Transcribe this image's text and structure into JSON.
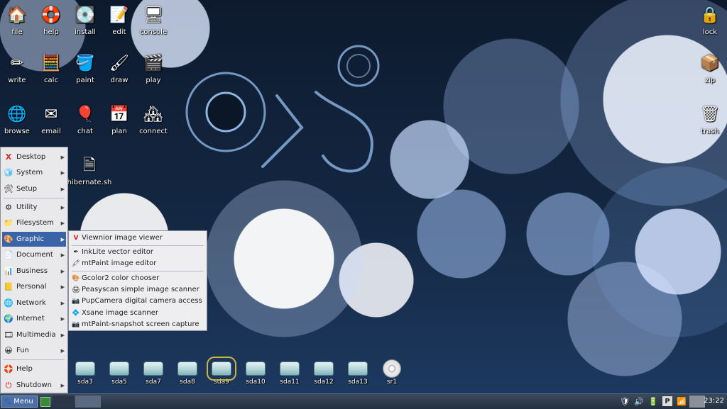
{
  "desktop_icons": [
    {
      "label": "file",
      "icon": "home-folder-icon"
    },
    {
      "label": "help",
      "icon": "lifebuoy-icon"
    },
    {
      "label": "install",
      "icon": "install-icon"
    },
    {
      "label": "edit",
      "icon": "edit-icon"
    },
    {
      "label": "console",
      "icon": "terminal-icon"
    },
    {
      "label": "write",
      "icon": "pen-icon"
    },
    {
      "label": "calc",
      "icon": "calculator-icon"
    },
    {
      "label": "paint",
      "icon": "paint-bucket-icon"
    },
    {
      "label": "draw",
      "icon": "draw-icon"
    },
    {
      "label": "play",
      "icon": "media-play-icon"
    },
    {
      "label": "browse",
      "icon": "globe-icon"
    },
    {
      "label": "email",
      "icon": "envelope-icon"
    },
    {
      "label": "chat",
      "icon": "chat-balloon-icon"
    },
    {
      "label": "plan",
      "icon": "calendar-icon"
    },
    {
      "label": "connect",
      "icon": "network-connect-icon"
    },
    {
      "label": "hibernate.sh",
      "icon": "script-file-icon"
    }
  ],
  "right_icons": [
    {
      "label": "lock",
      "icon": "padlock-icon"
    },
    {
      "label": "zip",
      "icon": "archive-box-icon"
    },
    {
      "label": "trash",
      "icon": "trash-can-icon"
    }
  ],
  "menu": {
    "items": [
      {
        "label": "Desktop",
        "icon": "desktop-x-icon"
      },
      {
        "label": "System",
        "icon": "system-icon"
      },
      {
        "label": "Setup",
        "icon": "setup-tools-icon"
      },
      {
        "label": "Utility",
        "icon": "utility-icon"
      },
      {
        "label": "Filesystem",
        "icon": "folder-icon"
      },
      {
        "label": "Graphic",
        "icon": "graphic-icon"
      },
      {
        "label": "Document",
        "icon": "document-icon"
      },
      {
        "label": "Business",
        "icon": "business-icon"
      },
      {
        "label": "Personal",
        "icon": "personal-icon"
      },
      {
        "label": "Network",
        "icon": "network-icon"
      },
      {
        "label": "Internet",
        "icon": "internet-icon"
      },
      {
        "label": "Multimedia",
        "icon": "multimedia-icon"
      },
      {
        "label": "Fun",
        "icon": "smiley-icon"
      },
      {
        "label": "Help",
        "icon": "help-lifebuoy-icon"
      },
      {
        "label": "Shutdown",
        "icon": "power-icon"
      }
    ],
    "active": "Graphic"
  },
  "submenu": {
    "items": [
      {
        "label": "Viewnior image viewer",
        "icon": "viewnior-icon"
      },
      {
        "label": "InkLite vector editor",
        "icon": "inklite-icon"
      },
      {
        "label": "mtPaint image editor",
        "icon": "mtpaint-icon"
      },
      {
        "label": "Gcolor2 color chooser",
        "icon": "color-chooser-icon"
      },
      {
        "label": "Peasyscan simple image scanner",
        "icon": "scanner-icon"
      },
      {
        "label": "PupCamera digital camera access",
        "icon": "camera-icon"
      },
      {
        "label": "Xsane image scanner",
        "icon": "xsane-icon"
      },
      {
        "label": "mtPaint-snapshot screen capture",
        "icon": "camera-snapshot-icon"
      }
    ]
  },
  "drives": [
    {
      "label": "sda3"
    },
    {
      "label": "sda5"
    },
    {
      "label": "sda7"
    },
    {
      "label": "sda8"
    },
    {
      "label": "sda9"
    },
    {
      "label": "sda10"
    },
    {
      "label": "sda11"
    },
    {
      "label": "sda12"
    },
    {
      "label": "sda13"
    },
    {
      "label": "sr1"
    }
  ],
  "selected_drive": "sda9",
  "taskbar": {
    "menu_label": "Menu",
    "clock": "23:22"
  },
  "colors": {
    "accent": "#3a63a8",
    "selection_outline": "#c9b63a"
  }
}
